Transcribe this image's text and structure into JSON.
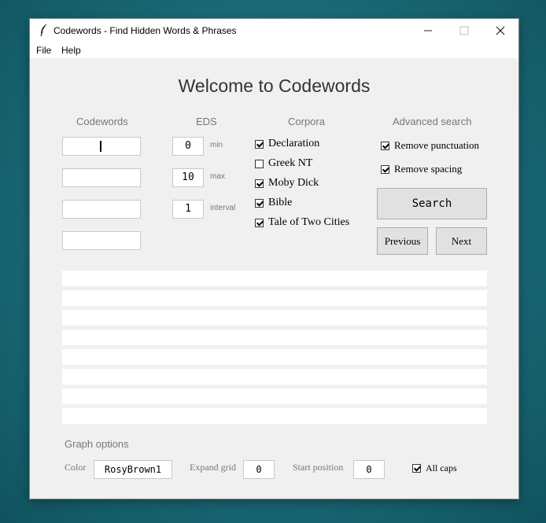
{
  "window": {
    "title": "Codewords - Find Hidden Words & Phrases"
  },
  "menu": {
    "file": "File",
    "help": "Help"
  },
  "welcome": "Welcome to Codewords",
  "columns": {
    "codewords": "Codewords",
    "eds": "EDS",
    "corpora": "Corpora",
    "advanced": "Advanced search"
  },
  "codewords_inputs": [
    "",
    "",
    "",
    ""
  ],
  "eds": {
    "min": {
      "value": "0",
      "label": "min"
    },
    "max": {
      "value": "10",
      "label": "max"
    },
    "interval": {
      "value": "1",
      "label": "interval"
    }
  },
  "corpora": [
    {
      "label": "Declaration",
      "checked": true
    },
    {
      "label": "Greek NT",
      "checked": false
    },
    {
      "label": "Moby Dick",
      "checked": true
    },
    {
      "label": "Bible",
      "checked": true
    },
    {
      "label": "Tale of Two Cities",
      "checked": true
    }
  ],
  "advanced": {
    "remove_punctuation": {
      "label": "Remove punctuation",
      "checked": true
    },
    "remove_spacing": {
      "label": "Remove spacing",
      "checked": true
    }
  },
  "buttons": {
    "search": "Search",
    "previous": "Previous",
    "next": "Next"
  },
  "results": [
    "",
    "",
    "",
    "",
    "",
    "",
    "",
    ""
  ],
  "graph": {
    "heading": "Graph options",
    "color_label": "Color",
    "color_value": "RosyBrown1",
    "expand_label": "Expand grid",
    "expand_value": "0",
    "start_label": "Start position",
    "start_value": "0",
    "allcaps_label": "All caps",
    "allcaps_checked": true
  }
}
